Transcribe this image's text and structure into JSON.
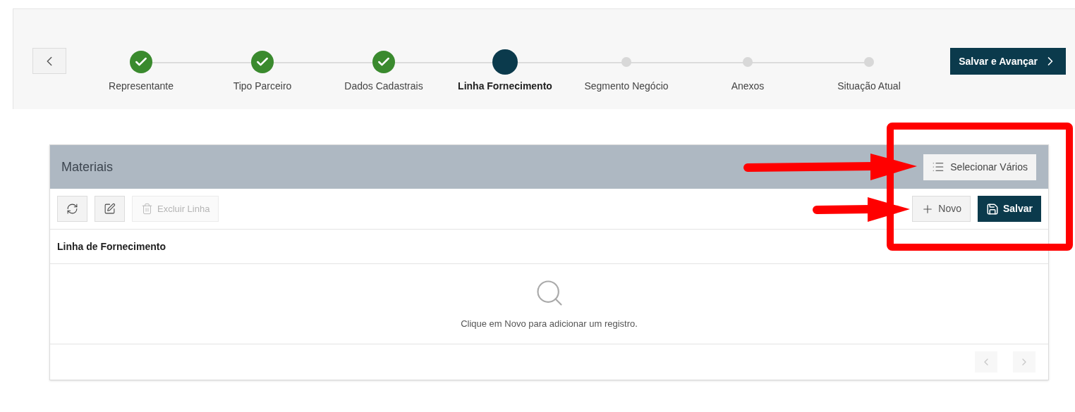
{
  "stepper": {
    "steps": [
      {
        "label": "Representante",
        "kind": "done"
      },
      {
        "label": "Tipo Parceiro",
        "kind": "done"
      },
      {
        "label": "Dados Cadastrais",
        "kind": "done"
      },
      {
        "label": "Linha Fornecimento",
        "kind": "current"
      },
      {
        "label": "Segmento Negócio",
        "kind": "pending"
      },
      {
        "label": "Anexos",
        "kind": "pending"
      },
      {
        "label": "Situação Atual",
        "kind": "pending"
      }
    ],
    "next_button": "Salvar e Avançar"
  },
  "panel": {
    "title": "Materiais",
    "select_many_button": "Selecionar Vários",
    "toolbar": {
      "delete_button": {
        "label": "Excluir Linha",
        "disabled": true
      },
      "new_button": "Novo",
      "save_button": "Salvar"
    },
    "table": {
      "columns": [
        "Linha de Fornecimento"
      ],
      "empty_message": "Clique em Novo para adicionar um registro."
    },
    "pagination": {
      "prev_disabled": true,
      "next_disabled": true
    }
  }
}
